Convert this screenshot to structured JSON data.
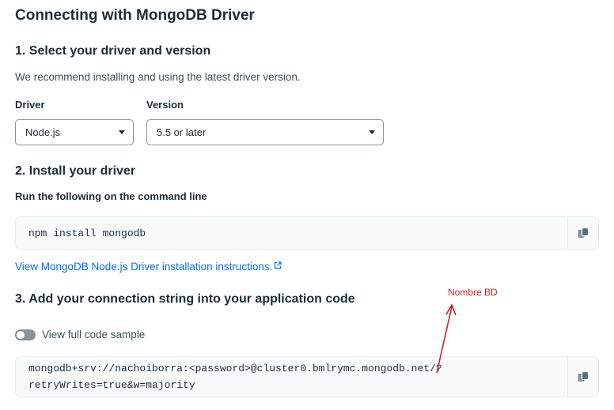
{
  "title": "Connecting with MongoDB Driver",
  "step1": {
    "heading": "1. Select your driver and version",
    "description": "We recommend installing and using the latest driver version.",
    "driver_label": "Driver",
    "driver_value": "Node.js",
    "version_label": "Version",
    "version_value": "5.5 or later"
  },
  "step2": {
    "heading": "2. Install your driver",
    "subheading": "Run the following on the command line",
    "command": "npm install mongodb",
    "link_text": "View MongoDB Node.js Driver installation instructions."
  },
  "step3": {
    "heading": "3. Add your connection string into your application code",
    "toggle_label": "View full code sample",
    "toggle_on": false,
    "connection_line1": "mongodb+srv://nachoiborra:<password>@cluster0.bmlrymc.mongodb.net/?",
    "connection_line2": "retryWrites=true&w=majority"
  },
  "annotation": {
    "text": "Nombre BD",
    "color": "#d21f1f"
  },
  "icons": {
    "copy": "copy-icon",
    "external": "external-link-icon",
    "dropdown": "chevron-down-icon"
  },
  "colors": {
    "accent_link": "#016bf8",
    "text_primary": "#1c2d38",
    "code_bg": "#f9fbfa"
  }
}
